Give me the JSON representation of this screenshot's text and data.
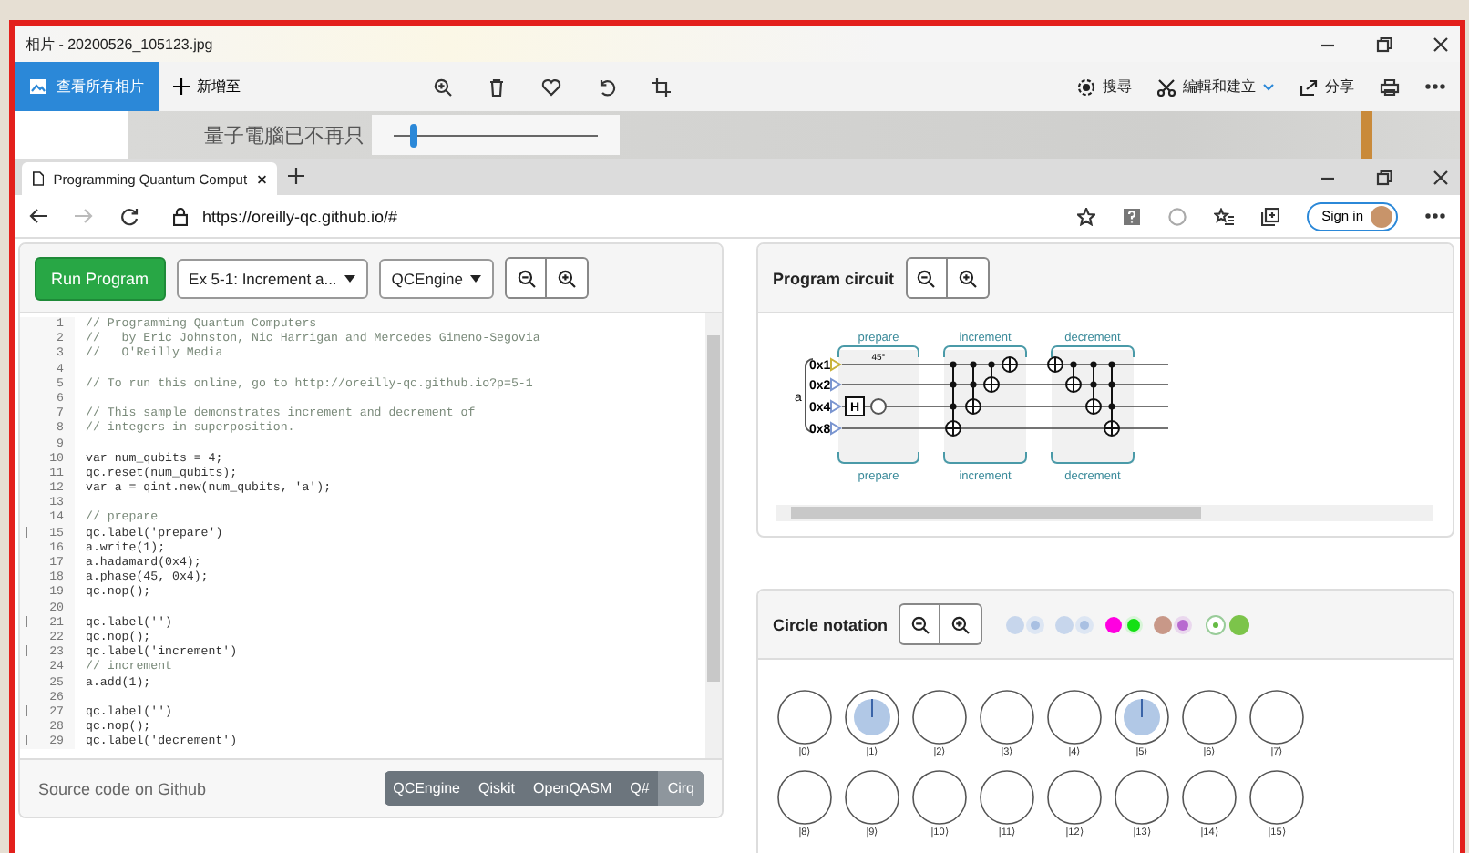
{
  "photos_window": {
    "title": "相片 - 20200526_105123.jpg",
    "toolbar": {
      "view_all": "查看所有相片",
      "add_to": "新增至",
      "search": "搜尋",
      "edit_create": "編輯和建立",
      "share": "分享"
    },
    "preview": {
      "caption": "量子電腦已不再只",
      "zoom": {
        "level": 0.08
      }
    }
  },
  "browser": {
    "tab_title": "Programming Quantum Comput",
    "url": "https://oreilly-qc.github.io/#",
    "sign_in": "Sign in"
  },
  "editor_panel": {
    "run_button": "Run Program",
    "example": "Ex 5-1: Increment a...",
    "engine": "QCEngine",
    "lines": [
      {
        "number": "1",
        "text": "// Programming Quantum Computers",
        "kind": "comment",
        "fold": false
      },
      {
        "number": "2",
        "text": "//   by Eric Johnston, Nic Harrigan and Mercedes Gimeno-Segovia",
        "kind": "comment",
        "fold": false
      },
      {
        "number": "3",
        "text": "//   O'Reilly Media",
        "kind": "comment",
        "fold": false
      },
      {
        "number": "4",
        "fold": false
      },
      {
        "number": "5",
        "text": "// To run this online, go to http://oreilly-qc.github.io?p=5-1",
        "kind": "comment",
        "fold": false
      },
      {
        "number": "6",
        "fold": false
      },
      {
        "number": "7",
        "text": "// This sample demonstrates increment and decrement of",
        "kind": "comment",
        "fold": false
      },
      {
        "number": "8",
        "text": "// integers in superposition.",
        "kind": "comment",
        "fold": false
      },
      {
        "number": "9",
        "fold": false
      },
      {
        "number": "10",
        "text": "var num_qubits = 4;",
        "kind": "code",
        "fold": false
      },
      {
        "number": "11",
        "text": "qc.reset(num_qubits);",
        "kind": "code",
        "fold": false
      },
      {
        "number": "12",
        "text": "var a = qint.new(num_qubits, 'a');",
        "kind": "code",
        "fold": false
      },
      {
        "number": "13",
        "fold": false
      },
      {
        "number": "14",
        "text": "// prepare",
        "kind": "comment",
        "fold": false
      },
      {
        "number": "15",
        "text": "qc.label('prepare')",
        "kind": "code",
        "fold": true
      },
      {
        "number": "16",
        "text": "a.write(1);",
        "kind": "code",
        "fold": false
      },
      {
        "number": "17",
        "text": "a.hadamard(0x4);",
        "kind": "code",
        "fold": false
      },
      {
        "number": "18",
        "text": "a.phase(45, 0x4);",
        "kind": "code",
        "fold": false
      },
      {
        "number": "19",
        "text": "qc.nop();",
        "kind": "code",
        "fold": false
      },
      {
        "number": "20",
        "fold": false
      },
      {
        "number": "21",
        "text": "qc.label('')",
        "kind": "code",
        "fold": true
      },
      {
        "number": "22",
        "text": "qc.nop();",
        "kind": "code",
        "fold": false
      },
      {
        "number": "23",
        "text": "qc.label('increment')",
        "kind": "code",
        "fold": true
      },
      {
        "number": "24",
        "text": "// increment",
        "kind": "comment",
        "fold": false
      },
      {
        "number": "25",
        "text": "a.add(1);",
        "kind": "code",
        "fold": false
      },
      {
        "number": "26",
        "fold": false
      },
      {
        "number": "27",
        "text": "qc.label('')",
        "kind": "code",
        "fold": true
      },
      {
        "number": "28",
        "text": "qc.nop();",
        "kind": "code",
        "fold": false
      },
      {
        "number": "29",
        "text": "qc.label('decrement')",
        "kind": "code",
        "fold": true
      }
    ],
    "footer": "Source code on Github",
    "languages": [
      {
        "label": "QCEngine",
        "selected": false
      },
      {
        "label": "Qiskit",
        "selected": false
      },
      {
        "label": "OpenQASM",
        "selected": false
      },
      {
        "label": "Q#",
        "selected": false
      },
      {
        "label": "Cirq",
        "selected": true
      }
    ]
  },
  "circuit_panel": {
    "title": "Program circuit",
    "register": "a",
    "qubits": [
      "0x1",
      "0x2",
      "0x4",
      "0x8"
    ],
    "phase": "45°",
    "gate": "H",
    "sections": [
      {
        "top": "prepare",
        "bottom": "prepare"
      },
      {
        "top": "increment",
        "bottom": "increment"
      },
      {
        "top": "decrement",
        "bottom": "decrement"
      }
    ]
  },
  "circle_panel": {
    "title": "Circle notation",
    "states": [
      {
        "label": "|0⟩",
        "occupied": false
      },
      {
        "label": "|1⟩",
        "occupied": true
      },
      {
        "label": "|2⟩",
        "occupied": false
      },
      {
        "label": "|3⟩",
        "occupied": false
      },
      {
        "label": "|4⟩",
        "occupied": false
      },
      {
        "label": "|5⟩",
        "occupied": true
      },
      {
        "label": "|6⟩",
        "occupied": false
      },
      {
        "label": "|7⟩",
        "occupied": false
      },
      {
        "label": "|8⟩",
        "occupied": false
      },
      {
        "label": "|9⟩",
        "occupied": false
      },
      {
        "label": "|10⟩",
        "occupied": false
      },
      {
        "label": "|11⟩",
        "occupied": false
      },
      {
        "label": "|12⟩",
        "occupied": false
      },
      {
        "label": "|13⟩",
        "occupied": false
      },
      {
        "label": "|14⟩",
        "occupied": false
      },
      {
        "label": "|15⟩",
        "occupied": false
      }
    ]
  }
}
